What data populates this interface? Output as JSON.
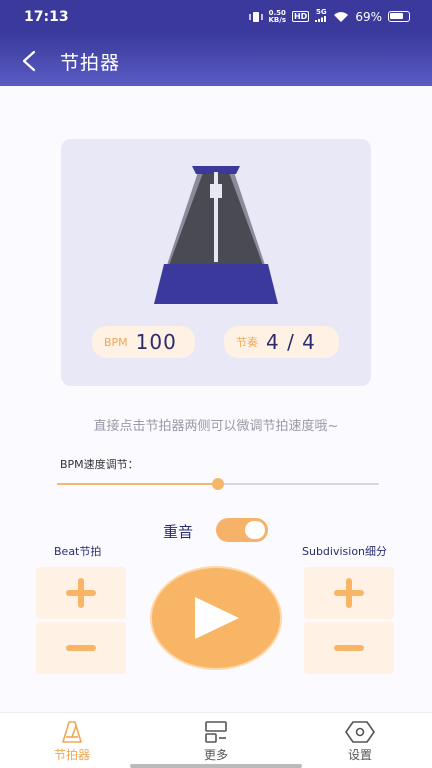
{
  "status_bar": {
    "time": "17:13",
    "net_speed_value": "0.50",
    "net_speed_unit": "KB/s",
    "hd_label": "HD",
    "signal_label": "5G",
    "battery_percent": "69%"
  },
  "header": {
    "title": "节拍器"
  },
  "metronome": {
    "bpm_label": "BPM",
    "bpm_value": "100",
    "rhythm_label": "节奏",
    "rhythm_value": "4 / 4"
  },
  "hint_text": "直接点击节拍器两侧可以微调节拍速度哦~",
  "speed": {
    "label": "BPM速度调节：",
    "slider_fraction": 0.5
  },
  "accent": {
    "label": "重音",
    "enabled": true
  },
  "beat": {
    "label": "Beat节拍"
  },
  "subdivision": {
    "label": "Subdivision细分"
  },
  "bottom_nav": {
    "items": [
      {
        "label": "节拍器",
        "icon": "metronome-icon",
        "active": true
      },
      {
        "label": "更多",
        "icon": "more-icon",
        "active": false
      },
      {
        "label": "设置",
        "icon": "settings-hexagon-icon",
        "active": false
      }
    ]
  },
  "colors": {
    "primary": "#3b3a9c",
    "accent_orange": "#f8b565",
    "pill_bg": "#fff1e4"
  }
}
